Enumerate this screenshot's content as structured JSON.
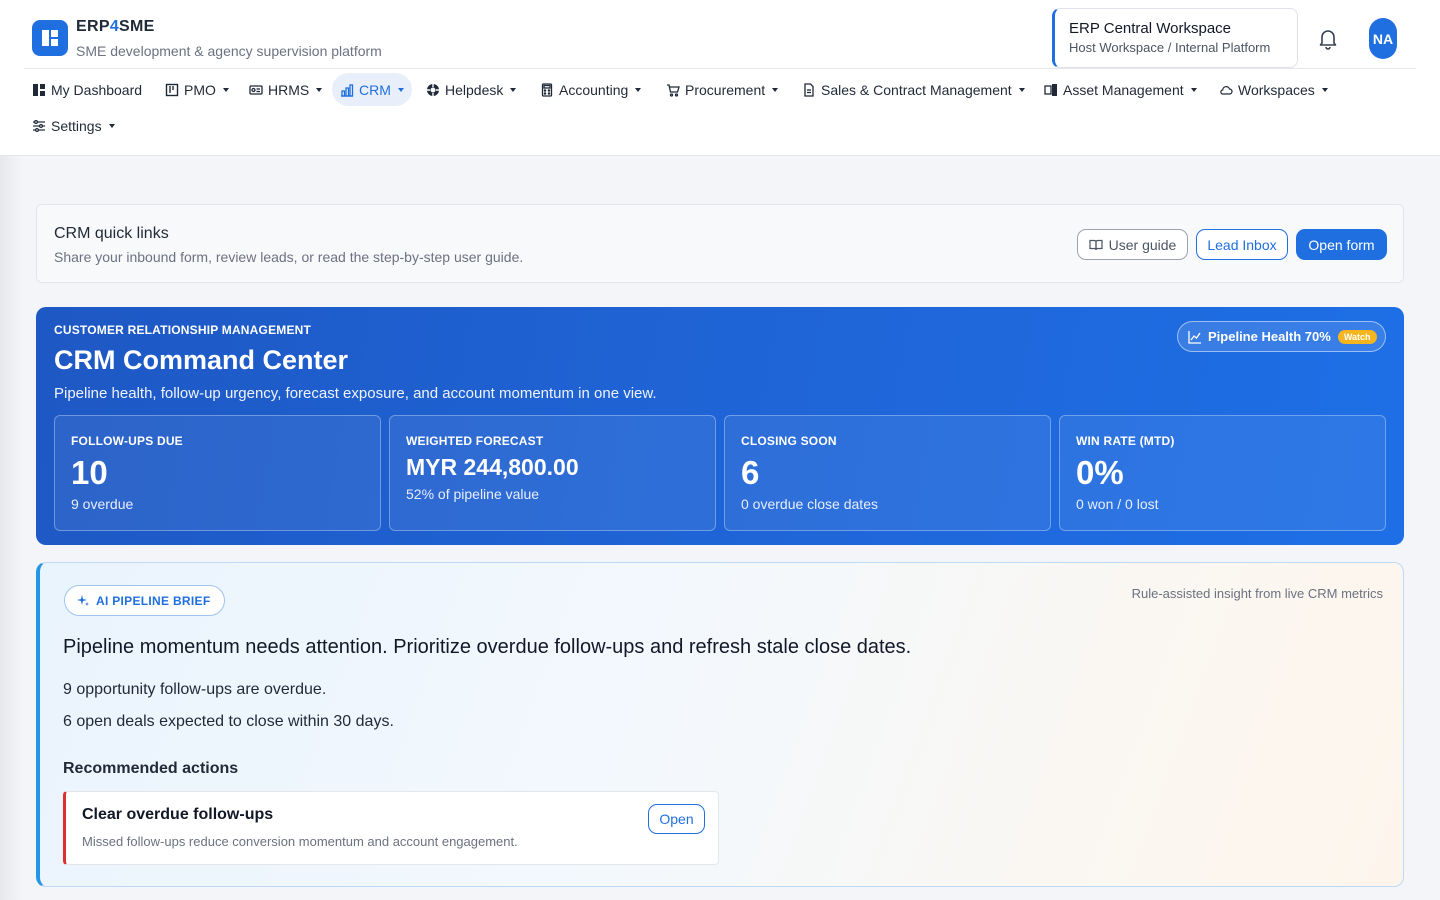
{
  "brand": {
    "name_prefix": "ERP",
    "name_accent": "4",
    "name_suffix": "SME",
    "subtitle": "SME development & agency supervision platform"
  },
  "workspace": {
    "name": "ERP Central Workspace",
    "subtitle": "Host Workspace / Internal Platform"
  },
  "user": {
    "initials": "NA"
  },
  "nav": [
    {
      "label": "My Dashboard",
      "icon": "dashboard-icon",
      "dropdown": false
    },
    {
      "label": "PMO",
      "icon": "board-icon",
      "dropdown": true
    },
    {
      "label": "HRMS",
      "icon": "id-card-icon",
      "dropdown": true
    },
    {
      "label": "CRM",
      "icon": "chart-icon",
      "dropdown": true,
      "active": true
    },
    {
      "label": "Helpdesk",
      "icon": "lifebuoy-icon",
      "dropdown": true
    },
    {
      "label": "Accounting",
      "icon": "calculator-icon",
      "dropdown": true
    },
    {
      "label": "Procurement",
      "icon": "cart-icon",
      "dropdown": true
    },
    {
      "label": "Sales & Contract Management",
      "icon": "document-icon",
      "dropdown": true
    },
    {
      "label": "Asset Management",
      "icon": "devices-icon",
      "dropdown": true
    },
    {
      "label": "Workspaces",
      "icon": "cloud-icon",
      "dropdown": true
    },
    {
      "label": "Settings",
      "icon": "sliders-icon",
      "dropdown": true
    }
  ],
  "quick_links": {
    "title": "CRM quick links",
    "subtitle": "Share your inbound form, review leads, or read the step-by-step user guide.",
    "user_guide": "User guide",
    "lead_inbox": "Lead Inbox",
    "open_form": "Open form"
  },
  "hero": {
    "kicker": "CUSTOMER RELATIONSHIP MANAGEMENT",
    "title": "CRM Command Center",
    "subtitle": "Pipeline health, follow-up urgency, forecast exposure, and account momentum in one view.",
    "health_label": "Pipeline Health 70%",
    "health_status": "Watch",
    "kpis": [
      {
        "label": "FOLLOW-UPS DUE",
        "value": "10",
        "note": "9 overdue"
      },
      {
        "label": "WEIGHTED FORECAST",
        "value": "MYR 244,800.00",
        "note": "52% of pipeline value"
      },
      {
        "label": "CLOSING SOON",
        "value": "6",
        "note": "0 overdue close dates"
      },
      {
        "label": "WIN RATE (MTD)",
        "value": "0%",
        "note": "0 won / 0 lost"
      }
    ]
  },
  "brief": {
    "badge": "AI PIPELINE BRIEF",
    "meta": "Rule-assisted insight from live CRM metrics",
    "headline": "Pipeline momentum needs attention. Prioritize overdue follow-ups and refresh stale close dates.",
    "lines": [
      "9 opportunity follow-ups are overdue.",
      "6 open deals expected to close within 30 days."
    ],
    "recommended_title": "Recommended actions",
    "action": {
      "title": "Clear overdue follow-ups",
      "description": "Missed follow-ups reduce conversion momentum and account engagement.",
      "button": "Open"
    }
  },
  "colors": {
    "accent": "#1f6fe0",
    "hero_start": "#1e58c4",
    "hero_end": "#1e6fe6",
    "watch": "#f5b51e",
    "danger": "#dc2f2f",
    "brief_border": "#2496e8"
  }
}
